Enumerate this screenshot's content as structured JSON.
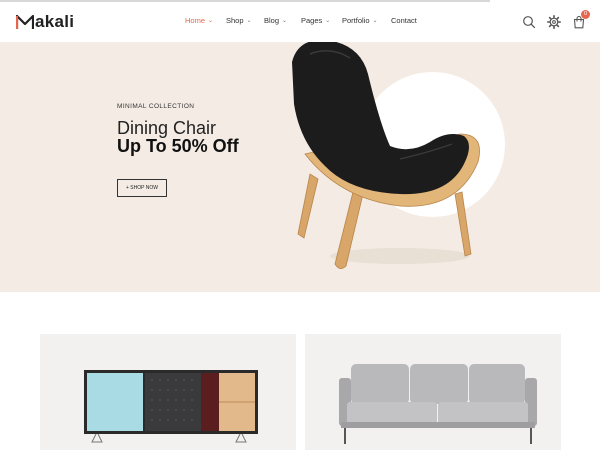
{
  "brand": {
    "name": "akali",
    "accent": "#e5654e"
  },
  "nav": {
    "items": [
      {
        "label": "Home",
        "active": true,
        "dropdown": true
      },
      {
        "label": "Shop",
        "active": false,
        "dropdown": true
      },
      {
        "label": "Blog",
        "active": false,
        "dropdown": true
      },
      {
        "label": "Pages",
        "active": false,
        "dropdown": true
      },
      {
        "label": "Portfolio",
        "active": false,
        "dropdown": true
      },
      {
        "label": "Contact",
        "active": false,
        "dropdown": false
      }
    ],
    "chevron": "⌄"
  },
  "header_icons": {
    "search": "search-icon",
    "settings": "gear-icon",
    "cart": "cart-icon",
    "cart_count": "0"
  },
  "hero": {
    "subtitle": "MINIMAL COLLECTION",
    "title": "Dining Chair",
    "title_bold": "Up To 50% Off",
    "button": "+ SHOP NOW",
    "background": "#f4ece4"
  },
  "products": [
    {
      "image": "sideboard-cabinet"
    },
    {
      "image": "grey-sofa"
    }
  ]
}
